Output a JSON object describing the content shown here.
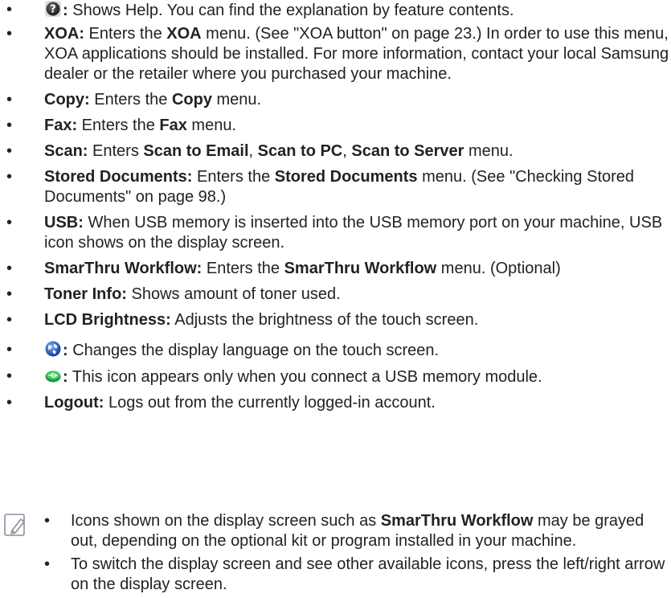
{
  "bullet": "•",
  "items": [
    {
      "key": "help",
      "icon": "help-icon",
      "suffix": ":",
      "text": " Shows Help. You can find the explanation by feature contents."
    },
    {
      "key": "xoa",
      "label": "XOA:",
      "t1": " Enters the ",
      "b1": "XOA",
      "t2": " menu. (See \"XOA button\" on page 23.) In order to use this menu, XOA applications should be installed. For more information, contact your local Samsung dealer or the retailer where you purchased your machine."
    },
    {
      "key": "copy",
      "label": "Copy:",
      "t1": " Enters the ",
      "b1": "Copy",
      "t2": " menu."
    },
    {
      "key": "fax",
      "label": "Fax:",
      "t1": " Enters the ",
      "b1": "Fax",
      "t2": " menu."
    },
    {
      "key": "scan",
      "label": "Scan:",
      "t1": " Enters ",
      "b1": "Scan to Email",
      "t2": ", ",
      "b2": "Scan to PC",
      "t3": ", ",
      "b3": "Scan to Server",
      "t4": " menu."
    },
    {
      "key": "stored",
      "label": "Stored Documents:",
      "t1": " Enters the ",
      "b1": "Stored Documents",
      "t2": " menu. (See \"Checking Stored Documents\" on page 98.)"
    },
    {
      "key": "usb",
      "label": "USB:",
      "t1": " When USB memory is inserted into the USB memory port on your machine, USB icon shows on the display screen."
    },
    {
      "key": "smarthru",
      "label": "SmarThru Workflow:",
      "t1": " Enters the ",
      "b1": "SmarThru Workflow",
      "t2": " menu. (Optional)"
    },
    {
      "key": "toner",
      "label": "Toner Info:",
      "t1": " Shows amount of toner used."
    },
    {
      "key": "lcd",
      "label": "LCD Brightness:",
      "t1": " Adjusts the brightness of the touch screen."
    },
    {
      "key": "language",
      "icon": "globe-icon",
      "suffix": ":",
      "text": " Changes the display language on the touch screen."
    },
    {
      "key": "usbmod",
      "icon": "usb-module-icon",
      "suffix": ":",
      "text": " This icon appears only when you connect a USB memory module."
    },
    {
      "key": "logout",
      "label": "Logout:",
      "t1": " Logs out from the currently logged-in account."
    }
  ],
  "note": {
    "icon": "note-pencil-icon",
    "items": [
      {
        "t1": "Icons shown on the display screen such as ",
        "b1": "SmarThru Workflow",
        "t2": " may be grayed out, depending on the optional kit or program installed in your machine."
      },
      {
        "t1": "To switch the display screen and see other available icons, press the left/right arrow on the display screen."
      }
    ]
  }
}
